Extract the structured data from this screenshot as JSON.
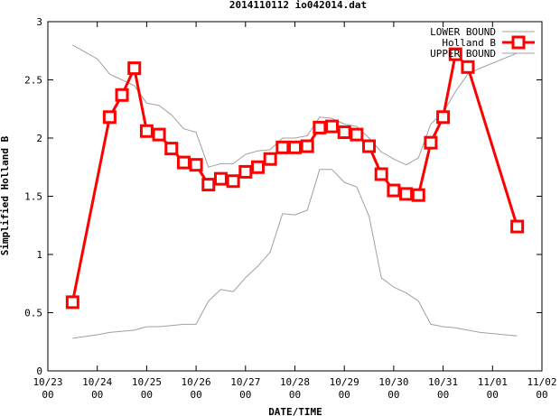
{
  "chart_data": {
    "type": "line",
    "title": "2014110112 io042014.dat",
    "xlabel": "DATE/TIME",
    "ylabel": "Simplified Holland B",
    "xlim": [
      "2014-10-23 00",
      "2014-11-02 00"
    ],
    "ylim": [
      0,
      3
    ],
    "x_ticks": [
      {
        "top": "10/23",
        "bottom": "00",
        "x": "2014-10-23 00"
      },
      {
        "top": "10/24",
        "bottom": "00",
        "x": "2014-10-24 00"
      },
      {
        "top": "10/25",
        "bottom": "00",
        "x": "2014-10-25 00"
      },
      {
        "top": "10/26",
        "bottom": "00",
        "x": "2014-10-26 00"
      },
      {
        "top": "10/27",
        "bottom": "00",
        "x": "2014-10-27 00"
      },
      {
        "top": "10/28",
        "bottom": "00",
        "x": "2014-10-28 00"
      },
      {
        "top": "10/29",
        "bottom": "00",
        "x": "2014-10-29 00"
      },
      {
        "top": "10/30",
        "bottom": "00",
        "x": "2014-10-30 00"
      },
      {
        "top": "10/31",
        "bottom": "00",
        "x": "2014-10-31 00"
      },
      {
        "top": "11/01",
        "bottom": "00",
        "x": "2014-11-01 00"
      },
      {
        "top": "11/02",
        "bottom": "00",
        "x": "2014-11-02 00"
      }
    ],
    "y_ticks": [
      "0",
      "0.5",
      "1",
      "1.5",
      "2",
      "2.5",
      "3"
    ],
    "grid": false,
    "legend_position": "top-right",
    "series": [
      {
        "name": "LOWER BOUND",
        "color": "#a0a0a0",
        "marker": "none",
        "x": [
          "2014-10-23 12",
          "2014-10-24 00",
          "2014-10-24 06",
          "2014-10-24 12",
          "2014-10-24 18",
          "2014-10-25 00",
          "2014-10-25 06",
          "2014-10-25 12",
          "2014-10-25 18",
          "2014-10-26 00",
          "2014-10-26 06",
          "2014-10-26 12",
          "2014-10-26 18",
          "2014-10-27 00",
          "2014-10-27 06",
          "2014-10-27 12",
          "2014-10-27 18",
          "2014-10-28 00",
          "2014-10-28 06",
          "2014-10-28 12",
          "2014-10-28 18",
          "2014-10-29 00",
          "2014-10-29 06",
          "2014-10-29 12",
          "2014-10-29 18",
          "2014-10-30 00",
          "2014-10-30 06",
          "2014-10-30 12",
          "2014-10-30 18",
          "2014-10-31 00",
          "2014-10-31 06",
          "2014-10-31 12",
          "2014-10-31 18",
          "2014-11-01 12"
        ],
        "values": [
          0.28,
          0.31,
          0.33,
          0.34,
          0.35,
          0.38,
          0.38,
          0.39,
          0.4,
          0.4,
          0.6,
          0.7,
          0.68,
          0.8,
          0.9,
          1.02,
          1.35,
          1.34,
          1.38,
          1.73,
          1.73,
          1.62,
          1.58,
          1.33,
          0.8,
          0.72,
          0.67,
          0.6,
          0.4,
          0.38,
          0.37,
          0.35,
          0.33,
          0.3
        ]
      },
      {
        "name": "Holland B",
        "color": "#ff0000",
        "marker": "square",
        "x": [
          "2014-10-23 12",
          "2014-10-24 06",
          "2014-10-24 12",
          "2014-10-24 18",
          "2014-10-25 00",
          "2014-10-25 06",
          "2014-10-25 12",
          "2014-10-25 18",
          "2014-10-26 00",
          "2014-10-26 06",
          "2014-10-26 12",
          "2014-10-26 18",
          "2014-10-27 00",
          "2014-10-27 06",
          "2014-10-27 12",
          "2014-10-27 18",
          "2014-10-28 00",
          "2014-10-28 06",
          "2014-10-28 12",
          "2014-10-28 18",
          "2014-10-29 00",
          "2014-10-29 06",
          "2014-10-29 12",
          "2014-10-29 18",
          "2014-10-30 00",
          "2014-10-30 06",
          "2014-10-30 12",
          "2014-10-30 18",
          "2014-10-31 00",
          "2014-10-31 06",
          "2014-10-31 12",
          "2014-11-01 12"
        ],
        "values": [
          0.59,
          2.18,
          2.37,
          2.6,
          2.06,
          2.03,
          1.91,
          1.79,
          1.77,
          1.6,
          1.65,
          1.63,
          1.71,
          1.75,
          1.82,
          1.92,
          1.92,
          1.93,
          2.09,
          2.1,
          2.05,
          2.03,
          1.93,
          1.69,
          1.55,
          1.52,
          1.51,
          1.96,
          2.18,
          2.72,
          2.61,
          1.24
        ]
      },
      {
        "name": "UPPER BOUND",
        "color": "#a0a0a0",
        "marker": "none",
        "x": [
          "2014-10-23 12",
          "2014-10-24 00",
          "2014-10-24 06",
          "2014-10-24 12",
          "2014-10-24 18",
          "2014-10-25 00",
          "2014-10-25 06",
          "2014-10-25 12",
          "2014-10-25 18",
          "2014-10-26 00",
          "2014-10-26 06",
          "2014-10-26 12",
          "2014-10-26 18",
          "2014-10-27 00",
          "2014-10-27 06",
          "2014-10-27 12",
          "2014-10-27 18",
          "2014-10-28 00",
          "2014-10-28 06",
          "2014-10-28 12",
          "2014-10-28 18",
          "2014-10-29 00",
          "2014-10-29 06",
          "2014-10-29 12",
          "2014-10-29 18",
          "2014-10-30 00",
          "2014-10-30 06",
          "2014-10-30 12",
          "2014-10-30 18",
          "2014-10-31 00",
          "2014-10-31 06",
          "2014-10-31 12",
          "2014-10-31 18",
          "2014-11-01 12"
        ],
        "values": [
          2.8,
          2.68,
          2.55,
          2.5,
          2.45,
          2.3,
          2.28,
          2.2,
          2.08,
          2.05,
          1.75,
          1.78,
          1.78,
          1.86,
          1.89,
          1.9,
          2.0,
          2.0,
          2.02,
          2.18,
          2.17,
          2.12,
          2.1,
          2.0,
          1.88,
          1.82,
          1.77,
          1.83,
          2.12,
          2.22,
          2.4,
          2.55,
          2.6,
          2.73
        ]
      }
    ]
  }
}
